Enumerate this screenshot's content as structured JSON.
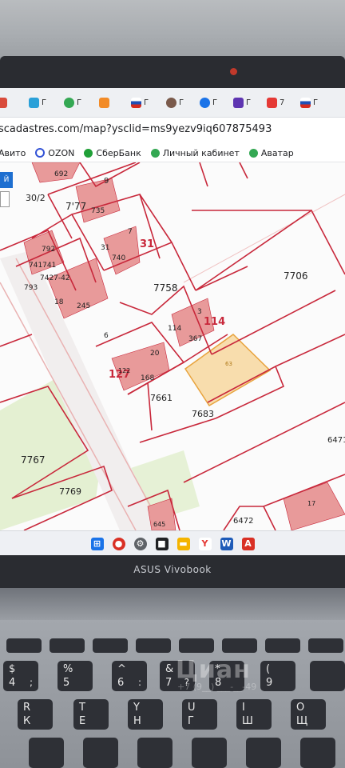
{
  "browser": {
    "tabs": [
      {
        "label": "",
        "color": "#d94b3b"
      },
      {
        "label": "Г",
        "color": "#2aa0d8"
      },
      {
        "label": "Г",
        "color": "#34a853"
      },
      {
        "label": "",
        "color": "#f28b27"
      },
      {
        "label": "Г",
        "color": "#c62828"
      },
      {
        "label": "Г",
        "color": "#7a5a4b"
      },
      {
        "label": "Г",
        "color": "#1a73e8"
      },
      {
        "label": "Г",
        "color": "#5e35b1"
      },
      {
        "label": "7",
        "color": "#e53935"
      },
      {
        "label": "Г",
        "color": "#c62828"
      }
    ],
    "address": "scadastres.com/map?ysclid=ms9yezv9iq607875493",
    "bookmarks": [
      {
        "label": "Авито",
        "icon": "avito-icon",
        "color": "#3fa9f5"
      },
      {
        "label": "OZON",
        "icon": "ozon-icon",
        "color": "#3353d6"
      },
      {
        "label": "СберБанк",
        "icon": "sber-icon",
        "color": "#21a038"
      },
      {
        "label": "Личный кабинет",
        "icon": "cabinet-icon",
        "color": "#34a853"
      },
      {
        "label": "Аватар",
        "icon": "avatar-icon",
        "color": "#34a853"
      }
    ]
  },
  "map": {
    "button_label": "Й",
    "side_label": "30/2",
    "parcel_labels": {
      "p692": "692",
      "p9": "9",
      "p777": "7'77",
      "p735": "735",
      "p7": "7",
      "p31big": "31",
      "p31": "31",
      "p792": "792",
      "p741": "741741",
      "p742": "7427-42",
      "p793": "793",
      "p740": "740",
      "p18": "18",
      "p245": "245",
      "p7758": "7758",
      "p7706": "7706",
      "p3": "3",
      "p114big": "114",
      "p114": "114",
      "p367": "367",
      "p6": "6",
      "p127": "127",
      "p122": "122",
      "p168": "168",
      "p20": "20",
      "p7661": "7661",
      "p7683": "7683",
      "p6471": "6471",
      "p7767": "7767",
      "p7769": "7769",
      "p6472": "6472",
      "p17": "17",
      "p645": "645",
      "p_sel": "63"
    },
    "colors": {
      "boundary": "#c8283b",
      "building": "#e89a9a",
      "selected": "#f6c46d",
      "green": "#dfeecb"
    }
  },
  "taskbar": [
    {
      "name": "windows-start-icon",
      "glyph": "⊞",
      "color": "#1a73e8"
    },
    {
      "name": "app-red-icon",
      "glyph": "●",
      "color": "#d93025"
    },
    {
      "name": "settings-icon",
      "glyph": "⚙",
      "color": "#3c4043"
    },
    {
      "name": "app-dark-icon",
      "glyph": "■",
      "color": "#202124"
    },
    {
      "name": "folder-icon",
      "glyph": "▬",
      "color": "#f4b400"
    },
    {
      "name": "yandex-browser-icon",
      "glyph": "Y",
      "color": "#e53935"
    },
    {
      "name": "word-icon",
      "glyph": "W",
      "color": "#1e5bb8"
    },
    {
      "name": "pdf-icon",
      "glyph": "A",
      "color": "#d93025"
    }
  ],
  "laptop": {
    "brand": "ASUS Vivobook"
  },
  "keyboard": {
    "row1": [
      {
        "a": "$",
        "b": "4",
        "c": ";"
      },
      {
        "a": "%",
        "b": "5",
        "c": ""
      },
      {
        "a": "^",
        "b": "6",
        "c": ":"
      },
      {
        "a": "&",
        "b": "7",
        "c": "?"
      },
      {
        "a": "*",
        "b": "8",
        "c": ""
      },
      {
        "a": "(",
        "b": "9",
        "c": ""
      }
    ],
    "row2": [
      {
        "a": "R",
        "b": "К",
        "c": ""
      },
      {
        "a": "T",
        "b": "Е",
        "c": ""
      },
      {
        "a": "Y",
        "b": "Н",
        "c": ""
      },
      {
        "a": "U",
        "b": "Г",
        "c": ""
      },
      {
        "a": "I",
        "b": "Ш",
        "c": ""
      },
      {
        "a": "O",
        "b": "Щ",
        "c": ""
      }
    ]
  },
  "watermark": {
    "line1": "Циан",
    "line2": "+7 (9__) ___-__-49"
  }
}
